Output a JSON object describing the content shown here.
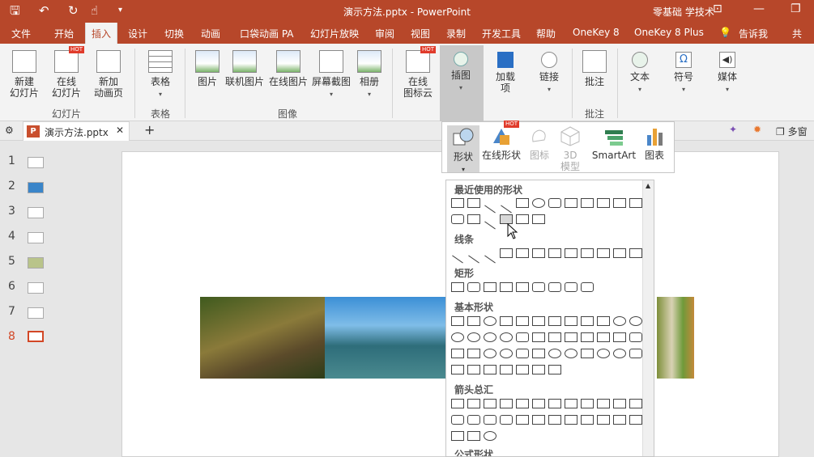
{
  "title_bar": {
    "document_title": "演示方法.pptx  -  PowerPoint",
    "user": "零基础 学技术",
    "quick_access": [
      "save-icon",
      "undo-icon",
      "redo-icon",
      "touch-mode-icon",
      "customize-icon"
    ]
  },
  "tabs": [
    "文件",
    "开始",
    "插入",
    "设计",
    "切换",
    "动画",
    "口袋动画 PA",
    "幻灯片放映",
    "审阅",
    "视图",
    "录制",
    "开发工具",
    "帮助",
    "OneKey 8",
    "OneKey 8 Plus",
    "告诉我",
    "共"
  ],
  "active_tab": "插入",
  "ribbon": {
    "new_slide": "新建\n幻灯片",
    "online_slide": "在线\n幻灯片",
    "new_anim_page": "新加\n动画页",
    "group_slides": "幻灯片",
    "table": "表格",
    "group_table": "表格",
    "picture": "图片",
    "online_picture": "联机图片",
    "online_pic2": "在线图片",
    "screenshot": "屏幕截图",
    "album": "相册",
    "group_images": "图像",
    "online_icon_cloud": "在线\n图标云",
    "illustrations": "插图",
    "addins": "加载\n项",
    "links": "链接",
    "comment": "批注",
    "group_comments": "批注",
    "text": "文本",
    "symbols": "符号",
    "media": "媒体",
    "hot": "HOT"
  },
  "doc_tab": {
    "name": "演示方法.pptx",
    "close": "✕",
    "add": "+",
    "right_label": "多窗"
  },
  "thumbnails": [
    "1",
    "2",
    "3",
    "4",
    "5",
    "6",
    "7",
    "8"
  ],
  "selected_slide": "8",
  "illus_panel": {
    "shapes": "形状",
    "online_shapes": "在线形状",
    "icons": "图标",
    "model3d": "3D\n模型",
    "smartart": "SmartArt",
    "chart": "图表"
  },
  "shapes_list": {
    "recent": "最近使用的形状",
    "lines": "线条",
    "rectangles": "矩形",
    "basic": "基本形状",
    "arrows": "箭头总汇",
    "equation": "公式形状"
  },
  "accent": "#b7472a"
}
